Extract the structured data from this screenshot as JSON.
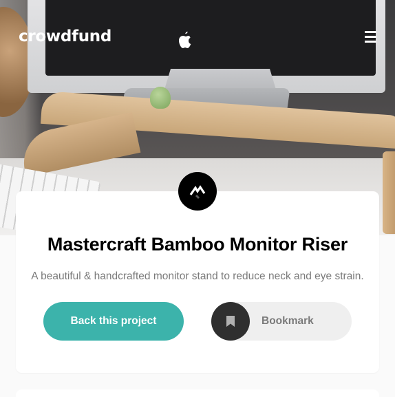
{
  "header": {
    "logo_text": "crowdfund",
    "menu_icon": "hamburger-menu-icon"
  },
  "hero": {
    "image_alt": "Bamboo monitor riser on desk"
  },
  "project_card": {
    "brand_icon": "mastercraft-logo-icon",
    "title": "Mastercraft Bamboo Monitor Riser",
    "description": "A beautiful & handcrafted monitor stand to reduce neck and eye strain.",
    "back_button_label": "Back this project",
    "bookmark_label": "Bookmark",
    "bookmark_icon": "bookmark-icon"
  },
  "colors": {
    "primary_cyan": "#3cb3ab",
    "dark": "#2f2f2f",
    "text_gray": "#7a7a7a",
    "background": "#fafafa"
  }
}
